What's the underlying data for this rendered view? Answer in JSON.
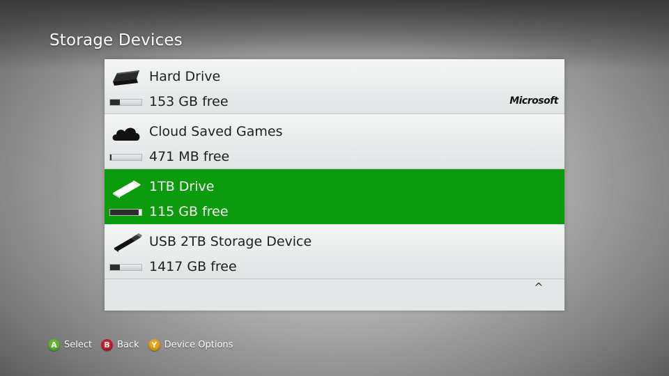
{
  "header": {
    "title": "Storage Devices"
  },
  "devices": [
    {
      "name": "Hard Drive",
      "free": "153 GB free",
      "icon": "hard-drive-icon",
      "usage_fraction": 0.3,
      "selected": false,
      "brand": "Microsoft"
    },
    {
      "name": "Cloud Saved Games",
      "free": "471 MB free",
      "icon": "cloud-icon",
      "usage_fraction": 0.05,
      "selected": false
    },
    {
      "name": "1TB Drive",
      "free": "115 GB free",
      "icon": "usb-drive-icon",
      "usage_fraction": 0.9,
      "selected": true
    },
    {
      "name": "USB 2TB Storage Device",
      "free": "1417 GB free",
      "icon": "usb-stick-icon",
      "usage_fraction": 0.3,
      "selected": false
    }
  ],
  "list": {
    "scroll_up_glyph": "^"
  },
  "footer": {
    "hints": [
      {
        "key": "A",
        "label": "Select",
        "color": "#5cb82d"
      },
      {
        "key": "B",
        "label": "Back",
        "color": "#c8202a"
      },
      {
        "key": "Y",
        "label": "Device Options",
        "color": "#e8a317"
      }
    ]
  },
  "colors": {
    "selected": "#0c9b0c",
    "meter_fill": "#2e2e2e"
  }
}
